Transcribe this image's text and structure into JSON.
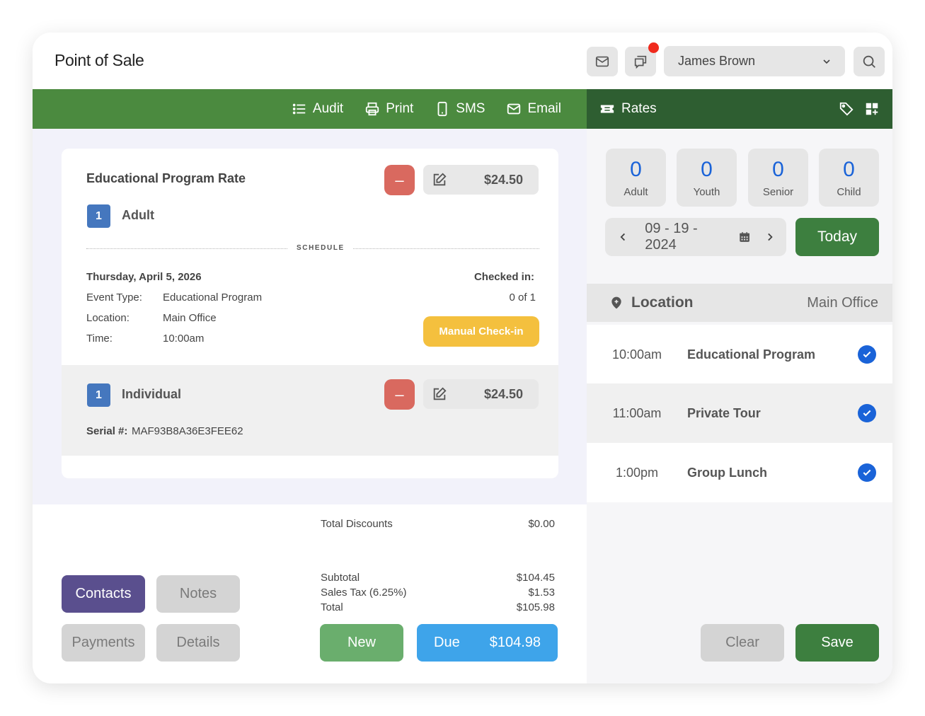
{
  "header": {
    "title": "Point of Sale",
    "user_name": "James Brown",
    "icons": {
      "mail": "mail-icon",
      "chat": "chat-icon",
      "search": "search-icon",
      "chevron": "chevron-down-icon"
    },
    "notification_dot_color": "#f02a1d"
  },
  "toolbar": {
    "items": [
      {
        "label": "Audit",
        "icon": "list-icon"
      },
      {
        "label": "Print",
        "icon": "printer-icon"
      },
      {
        "label": "SMS",
        "icon": "phone-icon"
      },
      {
        "label": "Email",
        "icon": "mail-icon"
      }
    ],
    "color": "#4b8a3f"
  },
  "rates": {
    "label": "Rates",
    "icons": [
      "ticket-icon",
      "tag-icon",
      "grid-add-icon"
    ],
    "color": "#2e5e31"
  },
  "order": {
    "item_title": "Educational Program Rate",
    "item_minus": "–",
    "item_price": "$24.50",
    "qty": "1",
    "qty_label": "Adult",
    "schedule_label": "SCHEDULE",
    "date": "Thursday, April 5, 2026",
    "event_type_label": "Event Type:",
    "event_type_value": "Educational Program",
    "location_label": "Location:",
    "location_value": "Main Office",
    "time_label": "Time:",
    "time_value": "10:00am",
    "checked_in_label": "Checked in:",
    "checked_in_value": "0 of 1",
    "manual_checkin": "Manual Check-in",
    "sub_qty": "1",
    "sub_label": "Individual",
    "sub_minus": "–",
    "sub_price": "$24.50",
    "serial_label": "Serial #:",
    "serial_value": "MAF93B8A36E3FEE62"
  },
  "totals": {
    "discounts_label": "Total Discounts",
    "discounts_value": "$0.00",
    "subtotal_label": "Subtotal",
    "subtotal_value": "$104.45",
    "tax_label": "Sales Tax (6.25%)",
    "tax_value": "$1.53",
    "total_label": "Total",
    "total_value": "$105.98"
  },
  "actions": {
    "contacts": "Contacts",
    "notes": "Notes",
    "payments": "Payments",
    "details": "Details",
    "new": "New",
    "due_label": "Due",
    "due_value": "$104.98",
    "clear": "Clear",
    "save": "Save"
  },
  "counts": [
    {
      "value": "0",
      "label": "Adult"
    },
    {
      "value": "0",
      "label": "Youth"
    },
    {
      "value": "0",
      "label": "Senior"
    },
    {
      "value": "0",
      "label": "Child"
    }
  ],
  "date_picker": {
    "value": "09 - 19 - 2024",
    "today": "Today"
  },
  "location": {
    "label": "Location",
    "value": "Main Office"
  },
  "events": [
    {
      "time": "10:00am",
      "name": "Educational Program",
      "checked": true
    },
    {
      "time": "11:00am",
      "name": "Private Tour",
      "checked": true
    },
    {
      "time": "1:00pm",
      "name": "Group Lunch",
      "checked": true
    }
  ]
}
